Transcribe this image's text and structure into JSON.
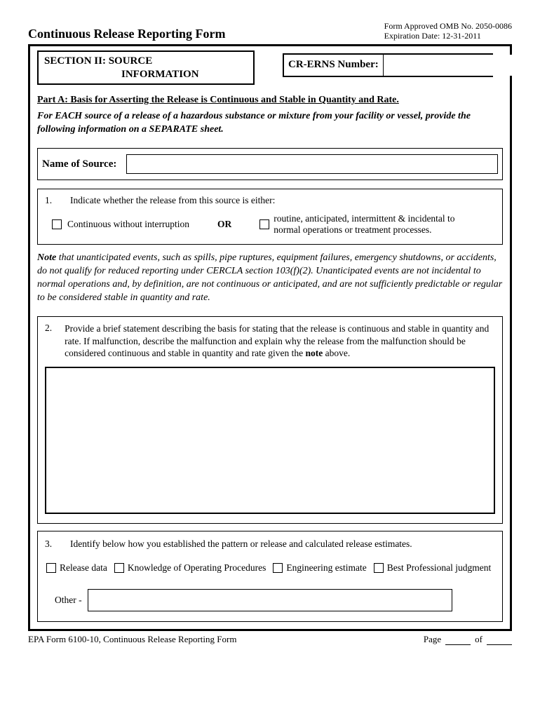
{
  "header": {
    "title": "Continuous Release Reporting Form",
    "approval_line1": "Form Approved OMB No. 2050-0086",
    "approval_line2": "Expiration Date:  12-31-2011"
  },
  "section": {
    "line1": "SECTION II:  SOURCE",
    "line2": "INFORMATION"
  },
  "crerns_label": "CR-ERNS Number:",
  "part_a": "Part A:  Basis for Asserting the Release is Continuous and Stable in Quantity and Rate.",
  "instruction": "For EACH source of a release of a hazardous substance or mixture from your facility or vessel, provide the following information on a SEPARATE sheet.",
  "source_label": "Name of Source:",
  "q1": {
    "num": "1.",
    "text": "Indicate whether the release from this source is either:",
    "option1": "Continuous without interruption",
    "or": "OR",
    "option2": "routine, anticipated, intermittent & incidental to normal operations or treatment processes."
  },
  "note": {
    "lead": "Note",
    "body": " that unanticipated events, such as spills, pipe ruptures, equipment failures, emergency shutdowns, or accidents, do not qualify for reduced reporting under CERCLA section 103(f)(2).  Unanticipated events are not incidental to normal operations and, by definition, are not continuous or anticipated, and are not sufficiently predictable or regular to be considered stable in quantity and rate."
  },
  "q2": {
    "num": "2.",
    "text_a": "Provide a brief statement describing the basis for stating that the release is continuous and stable in quantity and rate.  If malfunction, describe the malfunction and explain why the release from the malfunction should be considered continuous and stable in quantity and rate given the ",
    "note_word": "note",
    "text_b": " above."
  },
  "q3": {
    "num": "3.",
    "text": "Identify below how you established the pattern or release and calculated release estimates.",
    "opt1": "Release data",
    "opt2": "Knowledge of Operating Procedures",
    "opt3": "Engineering estimate",
    "opt4": "Best Professional judgment",
    "other_label": "Other -"
  },
  "footer": {
    "form_id": "EPA Form 6100-10, Continuous Release Reporting Form",
    "page_label": "Page",
    "of_label": "of"
  }
}
